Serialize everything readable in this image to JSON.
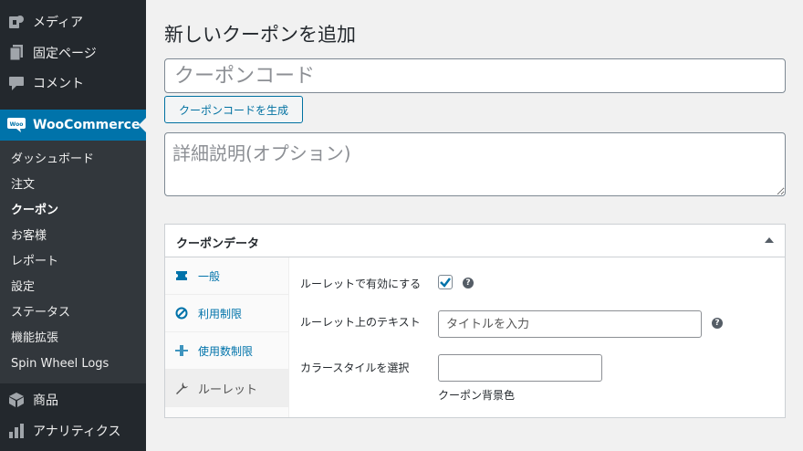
{
  "sidebar": {
    "top_items": [
      {
        "label": "メディア",
        "icon": "media-icon"
      },
      {
        "label": "固定ページ",
        "icon": "pages-icon"
      },
      {
        "label": "コメント",
        "icon": "comment-icon"
      }
    ],
    "active_item": {
      "label": "WooCommerce",
      "icon": "woocommerce-icon",
      "icon_text": "Woo"
    },
    "submenu": [
      "ダッシュボード",
      "注文",
      "クーポン",
      "お客様",
      "レポート",
      "設定",
      "ステータス",
      "機能拡張",
      "Spin Wheel Logs"
    ],
    "bottom_items": [
      {
        "label": "商品",
        "icon": "box-icon"
      },
      {
        "label": "アナリティクス",
        "icon": "chart-icon"
      }
    ]
  },
  "main": {
    "title": "新しいクーポンを追加",
    "coupon_code_placeholder": "クーポンコード",
    "generate_button": "クーポンコードを生成",
    "description_placeholder": "詳細説明(オプション)"
  },
  "panel": {
    "title": "クーポンデータ",
    "tabs": [
      {
        "label": "一般",
        "icon": "ticket-icon"
      },
      {
        "label": "利用制限",
        "icon": "restriction-icon"
      },
      {
        "label": "使用数制限",
        "icon": "limit-icon"
      },
      {
        "label": "ルーレット",
        "icon": "wrench-icon"
      }
    ],
    "fields": {
      "enable_label": "ルーレットで有効にする",
      "text_label": "ルーレット上のテキスト",
      "text_placeholder": "タイトルを入力",
      "color_label": "カラースタイルを選択",
      "color_description": "クーポン背景色"
    },
    "help_glyph": "?"
  },
  "colors": {
    "accent": "#0073aa",
    "sidebar_bg": "#23282d",
    "submenu_bg": "#32373c"
  }
}
